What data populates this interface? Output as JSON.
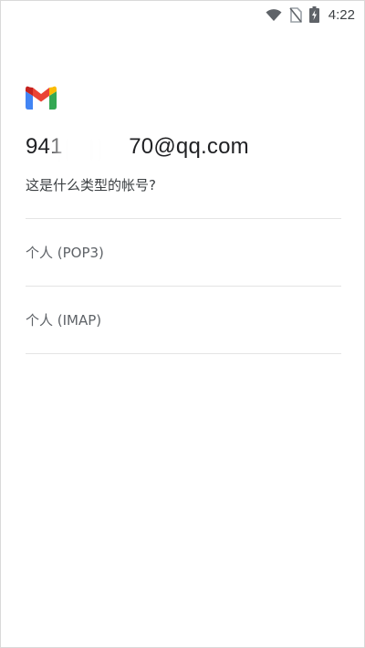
{
  "status_bar": {
    "time": "4:22",
    "icons": [
      "wifi-icon",
      "no-sim-icon",
      "battery-charging-icon"
    ]
  },
  "app": {
    "logo": "gmail-logo",
    "email": "941   70@qq.com",
    "question": "这是什么类型的帐号?"
  },
  "options": [
    {
      "label": "个人 (POP3)"
    },
    {
      "label": "个人 (IMAP)"
    }
  ],
  "colors": {
    "gmail_red": "#EA4335",
    "gmail_blue": "#4285F4",
    "gmail_green": "#34A853",
    "gmail_yellow": "#FBBC04",
    "divider": "#E4E4E4"
  }
}
